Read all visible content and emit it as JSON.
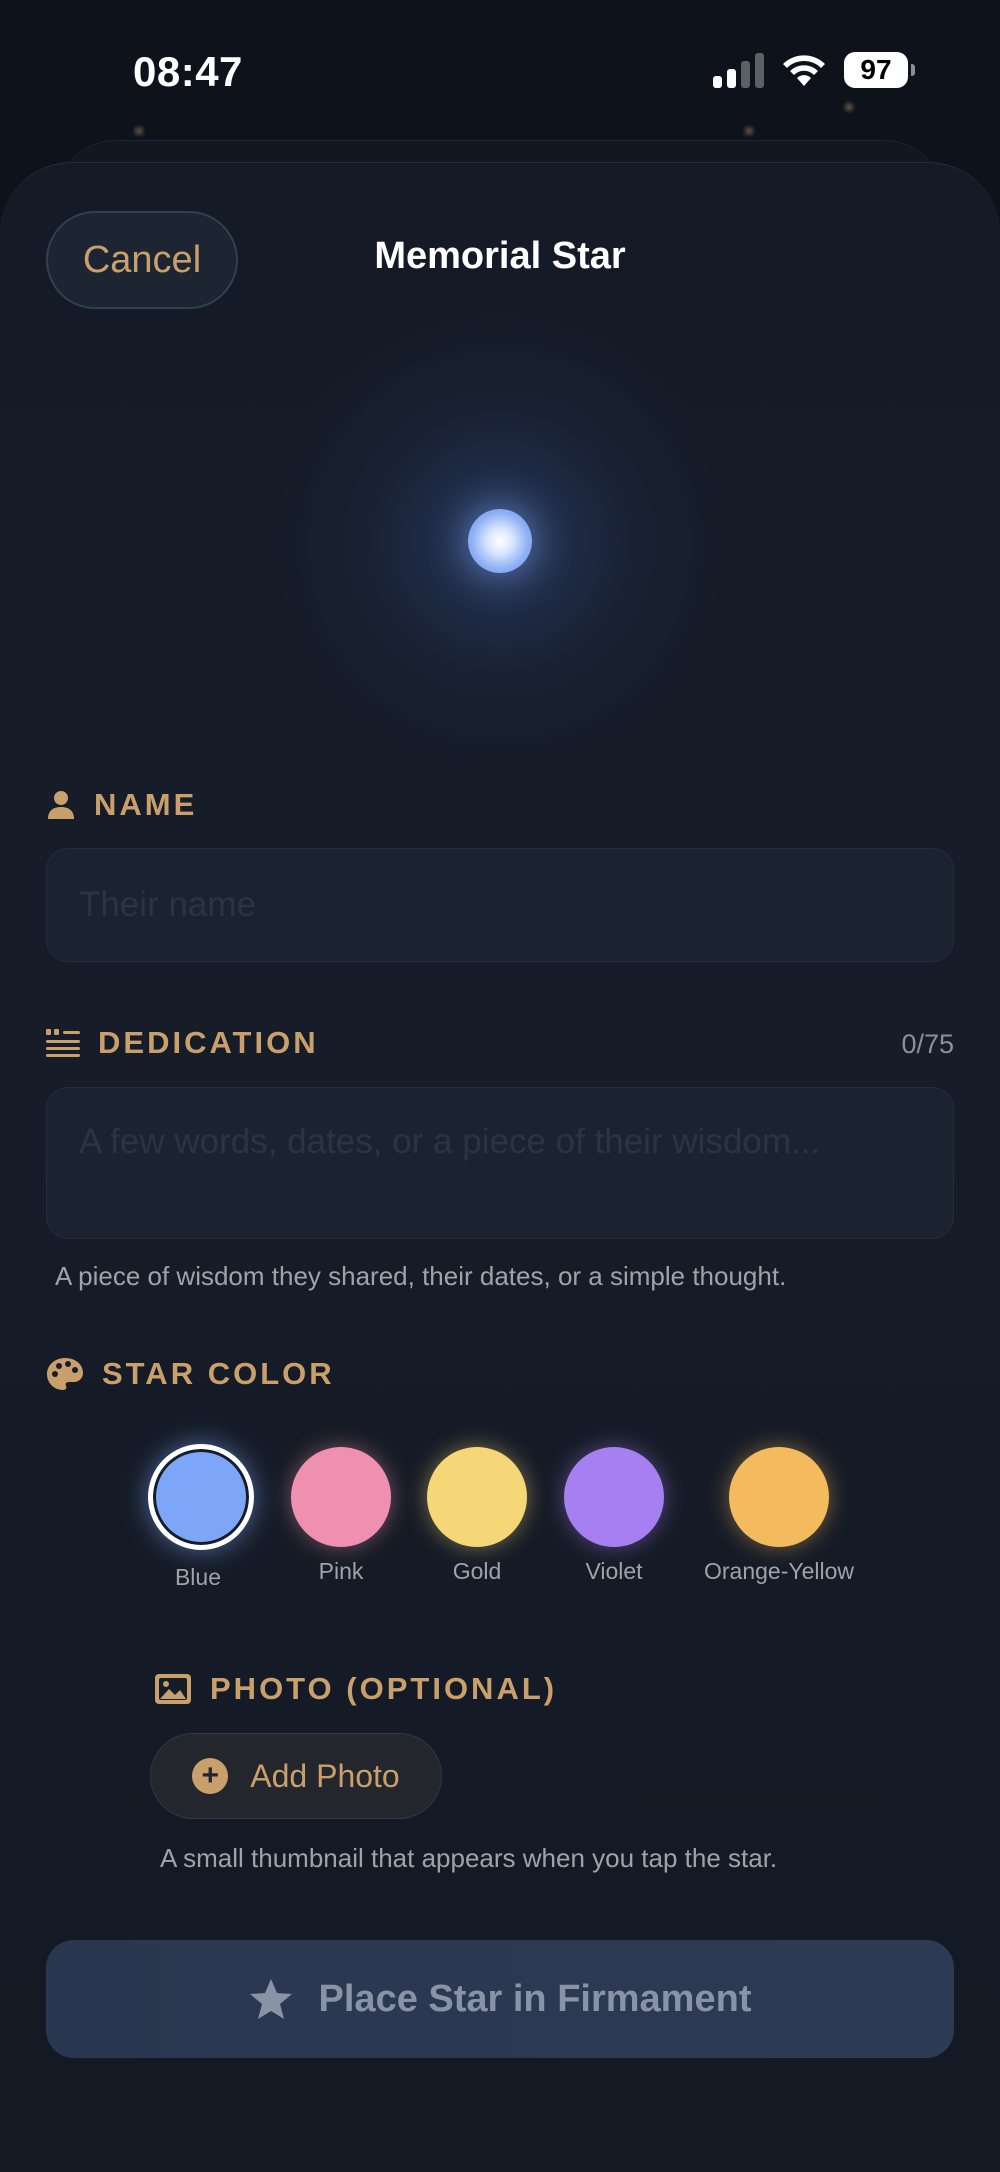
{
  "status_bar": {
    "time": "08:47",
    "battery": "97"
  },
  "header": {
    "cancel_label": "Cancel",
    "title": "Memorial Star"
  },
  "name_section": {
    "label": "NAME",
    "placeholder": "Their name"
  },
  "dedication_section": {
    "label": "DEDICATION",
    "counter": "0/75",
    "placeholder": "A few words, dates, or a piece of their wisdom...",
    "helper": "A piece of wisdom they shared, their dates, or a simple thought."
  },
  "color_section": {
    "label": "STAR COLOR",
    "selected": "Blue",
    "options": [
      {
        "name": "Blue",
        "color": "#7ea6f8"
      },
      {
        "name": "Pink",
        "color": "#ef90b0"
      },
      {
        "name": "Gold",
        "color": "#f6d778"
      },
      {
        "name": "Violet",
        "color": "#a67ff0"
      },
      {
        "name": "Orange-Yellow",
        "color": "#f4ba5e"
      }
    ]
  },
  "photo_section": {
    "label": "PHOTO (OPTIONAL)",
    "add_label": "Add Photo",
    "helper": "A small thumbnail that appears when you tap the star."
  },
  "submit": {
    "label": "Place Star in Firmament"
  },
  "colors": {
    "accent": "#c9a06c",
    "background": "#0d121b",
    "sheet": "#161c28"
  }
}
